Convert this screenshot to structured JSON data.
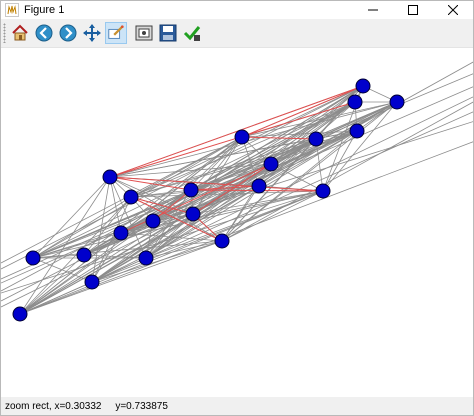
{
  "window": {
    "title": "Figure 1"
  },
  "toolbar": {
    "buttons": [
      {
        "name": "home-button",
        "icon": "home-icon"
      },
      {
        "name": "back-button",
        "icon": "back-arrow-icon"
      },
      {
        "name": "forward-button",
        "icon": "forward-arrow-icon"
      },
      {
        "name": "pan-button",
        "icon": "move-icon"
      },
      {
        "name": "zoom-button",
        "icon": "zoom-rect-icon",
        "active": true
      },
      {
        "name": "configure-subplots-button",
        "icon": "configure-icon"
      },
      {
        "name": "save-button",
        "icon": "floppy-disk-icon"
      },
      {
        "name": "edit-axis-button",
        "icon": "checkmark-icon"
      }
    ]
  },
  "status": {
    "text": "zoom rect, x=0.30332     y=0.733875"
  },
  "graph": {
    "node_color": "#0000cc",
    "gray_edge_color": "#8c8c8c",
    "red_edge_color": "#e05050"
  }
}
